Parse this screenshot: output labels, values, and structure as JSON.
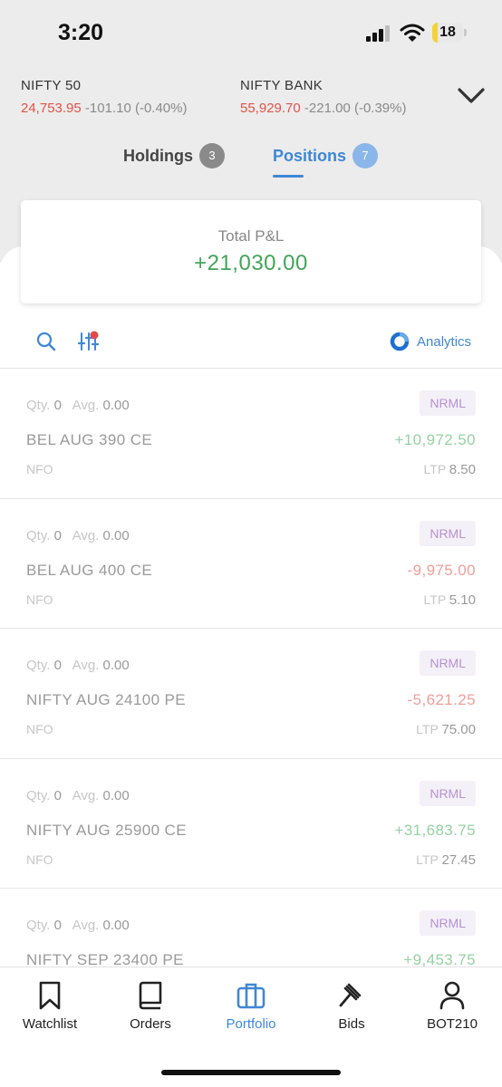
{
  "status_bar": {
    "time": "3:20",
    "battery": "18",
    "battery_level": 0.18
  },
  "indices": [
    {
      "name": "NIFTY 50",
      "price": "24,753.95",
      "change": "-101.10 (-0.40%)"
    },
    {
      "name": "NIFTY BANK",
      "price": "55,929.70",
      "change": "-221.00 (-0.39%)"
    }
  ],
  "tabs": [
    {
      "label": "Holdings",
      "count": "3"
    },
    {
      "label": "Positions",
      "count": "7"
    }
  ],
  "summary": {
    "label": "Total P&L",
    "value": "+21,030.00"
  },
  "toolbar": {
    "analytics_label": "Analytics"
  },
  "positions": [
    {
      "qty_label": "Qty.",
      "qty": "0",
      "avg_label": "Avg.",
      "avg": "0.00",
      "product": "NRML",
      "symbol": "BEL AUG 390 CE",
      "pnl": "+10,972.50",
      "exchange": "NFO",
      "ltp_label": "LTP",
      "ltp": "8.50"
    },
    {
      "qty_label": "Qty.",
      "qty": "0",
      "avg_label": "Avg.",
      "avg": "0.00",
      "product": "NRML",
      "symbol": "BEL AUG 400 CE",
      "pnl": "-9,975.00",
      "exchange": "NFO",
      "ltp_label": "LTP",
      "ltp": "5.10"
    },
    {
      "qty_label": "Qty.",
      "qty": "0",
      "avg_label": "Avg.",
      "avg": "0.00",
      "product": "NRML",
      "symbol": "NIFTY AUG 24100 PE",
      "pnl": "-5,621.25",
      "exchange": "NFO",
      "ltp_label": "LTP",
      "ltp": "75.00"
    },
    {
      "qty_label": "Qty.",
      "qty": "0",
      "avg_label": "Avg.",
      "avg": "0.00",
      "product": "NRML",
      "symbol": "NIFTY AUG 25900 CE",
      "pnl": "+31,683.75",
      "exchange": "NFO",
      "ltp_label": "LTP",
      "ltp": "27.45"
    },
    {
      "qty_label": "Qty.",
      "qty": "0",
      "avg_label": "Avg.",
      "avg": "0.00",
      "product": "NRML",
      "symbol": "NIFTY SEP 23400 PE",
      "pnl": "+9,453.75"
    }
  ],
  "bottom_nav": [
    {
      "label": "Watchlist",
      "icon": "bookmark-icon"
    },
    {
      "label": "Orders",
      "icon": "book-icon"
    },
    {
      "label": "Portfolio",
      "icon": "briefcase-icon"
    },
    {
      "label": "Bids",
      "icon": "gavel-icon"
    },
    {
      "label": "BOT210",
      "icon": "user-icon"
    }
  ],
  "colors": {
    "accent": "#3f87d6",
    "gain": "#43a35a",
    "loss": "#e0524a",
    "product_tag": "#b692cf"
  }
}
